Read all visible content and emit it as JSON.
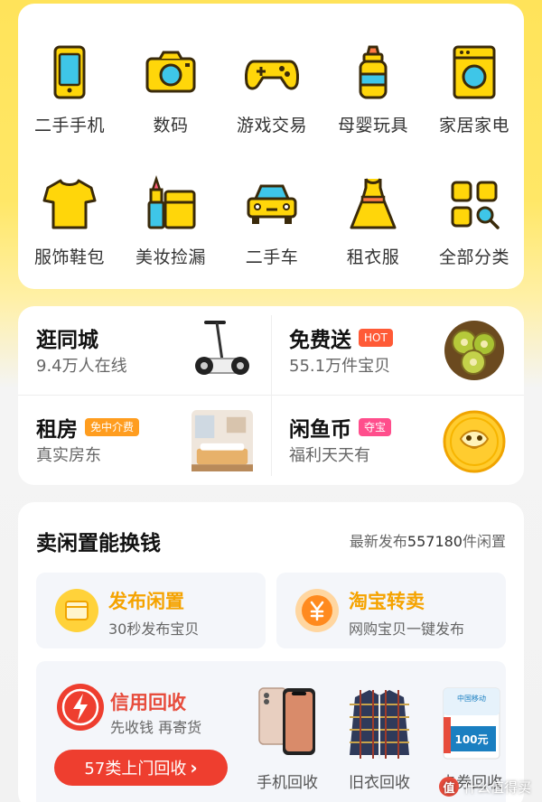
{
  "categories": [
    {
      "label": "二手手机",
      "icon": "phone-icon"
    },
    {
      "label": "数码",
      "icon": "camera-icon"
    },
    {
      "label": "游戏交易",
      "icon": "gamepad-icon"
    },
    {
      "label": "母婴玩具",
      "icon": "baby-bottle-icon"
    },
    {
      "label": "家居家电",
      "icon": "washing-machine-icon"
    },
    {
      "label": "服饰鞋包",
      "icon": "tshirt-icon"
    },
    {
      "label": "美妆捡漏",
      "icon": "lipstick-icon"
    },
    {
      "label": "二手车",
      "icon": "car-icon"
    },
    {
      "label": "租衣服",
      "icon": "dress-icon"
    },
    {
      "label": "全部分类",
      "icon": "all-categories-icon"
    }
  ],
  "features": [
    {
      "title": "逛同城",
      "subtitle": "9.4万人在线",
      "badge": "",
      "badge_color": "",
      "image": "segway-image"
    },
    {
      "title": "免费送",
      "subtitle": "55.1万件宝贝",
      "badge": "HOT",
      "badge_color": "#ff5a36",
      "image": "kiwi-image"
    },
    {
      "title": "租房",
      "subtitle": "真实房东",
      "badge": "免中介费",
      "badge_color": "#ff9d1f",
      "image": "room-image"
    },
    {
      "title": "闲鱼币",
      "subtitle": "福利天天有",
      "badge": "夺宝",
      "badge_color": "#ff4e8c",
      "image": "fish-coin-image"
    }
  ],
  "sell": {
    "title": "卖闲置能换钱",
    "latest_prefix": "最新发布",
    "latest_count": "557180",
    "latest_suffix": "件闲置",
    "publish": {
      "title": "发布闲置",
      "subtitle": "30秒发布宝贝"
    },
    "taobao": {
      "title": "淘宝转卖",
      "subtitle": "网购宝贝一键发布"
    },
    "recycle": {
      "title": "信用回收",
      "subtitle": "先收钱 再寄货",
      "button": "57类上门回收",
      "items": [
        {
          "label": "手机回收",
          "image": "iphone-image"
        },
        {
          "label": "旧衣回收",
          "image": "plaid-shirt-image"
        },
        {
          "label": "卡券回收",
          "image": "recharge-card-image"
        }
      ]
    }
  },
  "card_image_text": {
    "brand": "中国移动",
    "amount": "100元"
  },
  "watermark": "值 什么值得买",
  "colors": {
    "accent_yellow": "#ffd60a",
    "icon_outline": "#3a2a0a",
    "icon_blue": "#3ec6e8",
    "brand_orange": "#f5a300",
    "recycle_red": "#ee3e2f"
  }
}
